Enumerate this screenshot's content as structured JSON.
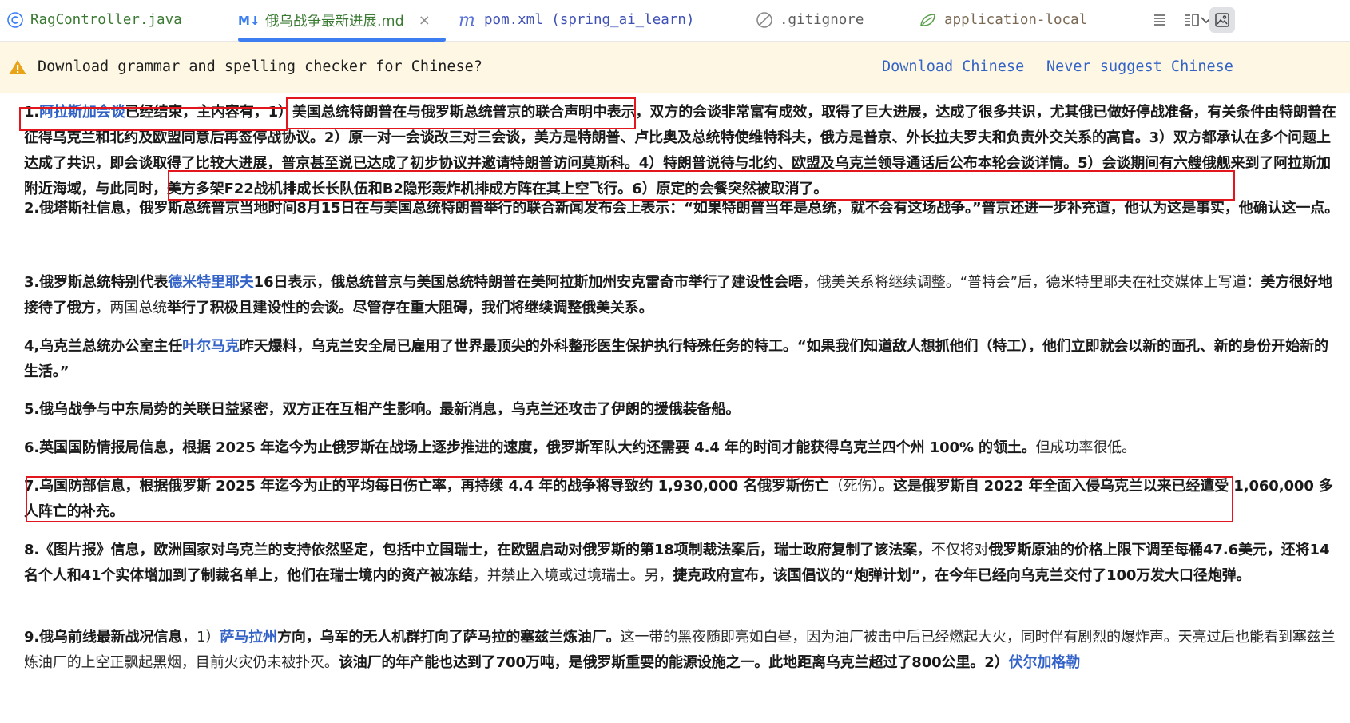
{
  "tabs": [
    {
      "label": "RagController.java",
      "icon": "class-icon"
    },
    {
      "label": "俄乌战争最新进展.md",
      "icon": "markdown-icon",
      "close": "×"
    },
    {
      "label": "pom.xml (spring_ai_learn)",
      "icon": "maven-icon"
    },
    {
      "label": ".gitignore",
      "icon": "ignore-icon"
    },
    {
      "label": "application-local",
      "icon": "spring-leaf-icon"
    }
  ],
  "banner": {
    "message": "Download grammar and spelling checker for Chinese?",
    "download_label": "Download Chinese",
    "never_label": "Never suggest Chinese"
  },
  "colors": {
    "accent": "#3c7ef2",
    "link": "#3463c7",
    "highlight": "#e3161e",
    "banner": "#fdf7e3"
  },
  "doc": {
    "p1": {
      "num": "1.",
      "link": "阿拉斯加会谈",
      "t1": "已经结束，主内容有，1）美国总统特朗普在与俄罗斯总统普京的联合声明中表示，双方的会谈非常富有成效，取得了巨大进展，达成了很多共识，尤其俄已做好停战准备，有关条件由特朗普在征得乌克兰和北约及欧盟同意后再签停战协议。2）原一对一会谈改三对三会谈，美方是特朗普、卢比奥及总统特使维特科夫，俄方是普京、外长拉夫罗夫和负责外交关系的高官。3）双方都承认在多个问题上达成了共识，即会谈取得了比较大进展，普京甚至说已达成了初步协议并邀请特朗普访问莫斯科。4）特朗普说待与北约、欧盟及乌克兰领导通话后公布本轮会谈详情。5）会谈期间有六艘俄舰来到了阿拉斯加附近海域，与此同时，美方多架F22战机排成长长队伍和B2隐形轰炸机排成方阵在其上空飞行。6）原定的会餐突然被取消了。"
    },
    "p2": {
      "t1": "2.俄塔斯社信息，俄罗斯总统普京当地时间8月15日在与美国总统特朗普举行的联合新闻发布会上表示：“如果特朗普当年是总统，就不会有这场战争。”普京还进一步补充道，他认为这是事实，他确认这一点。"
    },
    "p3": {
      "t1": "3.俄罗斯总统特别代表",
      "link": "德米特里耶夫",
      "t2": "16日表示，俄总统普京与美国总统特朗普在美阿拉斯加州安克雷奇市举行了建设性会晤",
      "n1": "，俄美关系将继续调整。“普特会”后，德米特里耶夫在社交媒体上写道：",
      "t3": "美方很好地接待了俄方",
      "n2": "，两国总统",
      "t4": "举行了积极且建设性的会谈。尽管存在重大阻碍，我们将继续调整俄美关系。"
    },
    "p4": {
      "t1": "4,乌克兰总统办公室主任",
      "link": "叶尔马克",
      "t2": "昨天爆料，乌克兰安全局已雇用了世界最顶尖的外科整形医生保护执行特殊任务的特工。“如果我们知道敌人想抓他们（特工），他们立即就会以新的面孔、新的身份开始新的生活。”"
    },
    "p5": {
      "t1": "5.俄乌战争与中东局势的关联日益紧密，双方正在互相产生影响。最新消息，乌克兰还攻击了伊朗的援俄装备船。"
    },
    "p6": {
      "t1": "6.英国国防情报局信息，根据 2025 年迄今为止俄罗斯在战场上逐步推进的速度，俄罗斯军队大约还需要 4.4 年的时间才能获得乌克兰四个州 100% 的领土。",
      "n1": "但成功率很低。"
    },
    "p7": {
      "t1": "7.乌国防部信息，根据俄罗斯 2025 年迄今为止的平均每日伤亡率，再持续 4.4 年的战争将导致约 1,930,000 名俄罗斯伤亡",
      "n1": "（死伤）",
      "t2": "。这是俄罗斯自 2022 年全面入侵乌克兰以来已经遭受 1,060,000 多人阵亡的补充。"
    },
    "p8": {
      "t1": "8.《图片报》信息，欧洲国家对乌克兰的支持依然坚定，包括中立国瑞士，在欧盟启动对俄罗斯的第18项制裁法案后，瑞士政府复制了该法案",
      "n1": "，不仅将对",
      "t2": "俄罗斯原油的价格上限下调至每桶47.6美元，还将14名个人和41个实体增加到了制裁名单上，他们在瑞士境内的资产被冻结",
      "n2": "，并禁止入境或过境瑞士。另，",
      "t3": "捷克政府宣布，该国倡议的“炮弹计划”，在今年已经向乌克兰交付了100万发大口径炮弹。"
    },
    "p9": {
      "t1": "9.俄乌前线最新战况信息",
      "n1": "，1）",
      "link1": "萨马拉州",
      "t2": "方向，乌军的无人机群打向了萨马拉的塞兹兰炼油厂。",
      "n2": "这一带的黑夜随即亮如白昼，因为油厂被击中后已经燃起大火，同时伴有剧烈的爆炸声。天亮过后也能看到塞兹兰炼油厂的上空正飘起黑烟，目前火灾仍未被扑灭。",
      "t3": "该油厂的年产能也达到了700万吨，是俄罗斯重要的能源设施之一。此地距离乌克兰超过了800公里。2）",
      "link2": "伏尔加格勒"
    }
  }
}
